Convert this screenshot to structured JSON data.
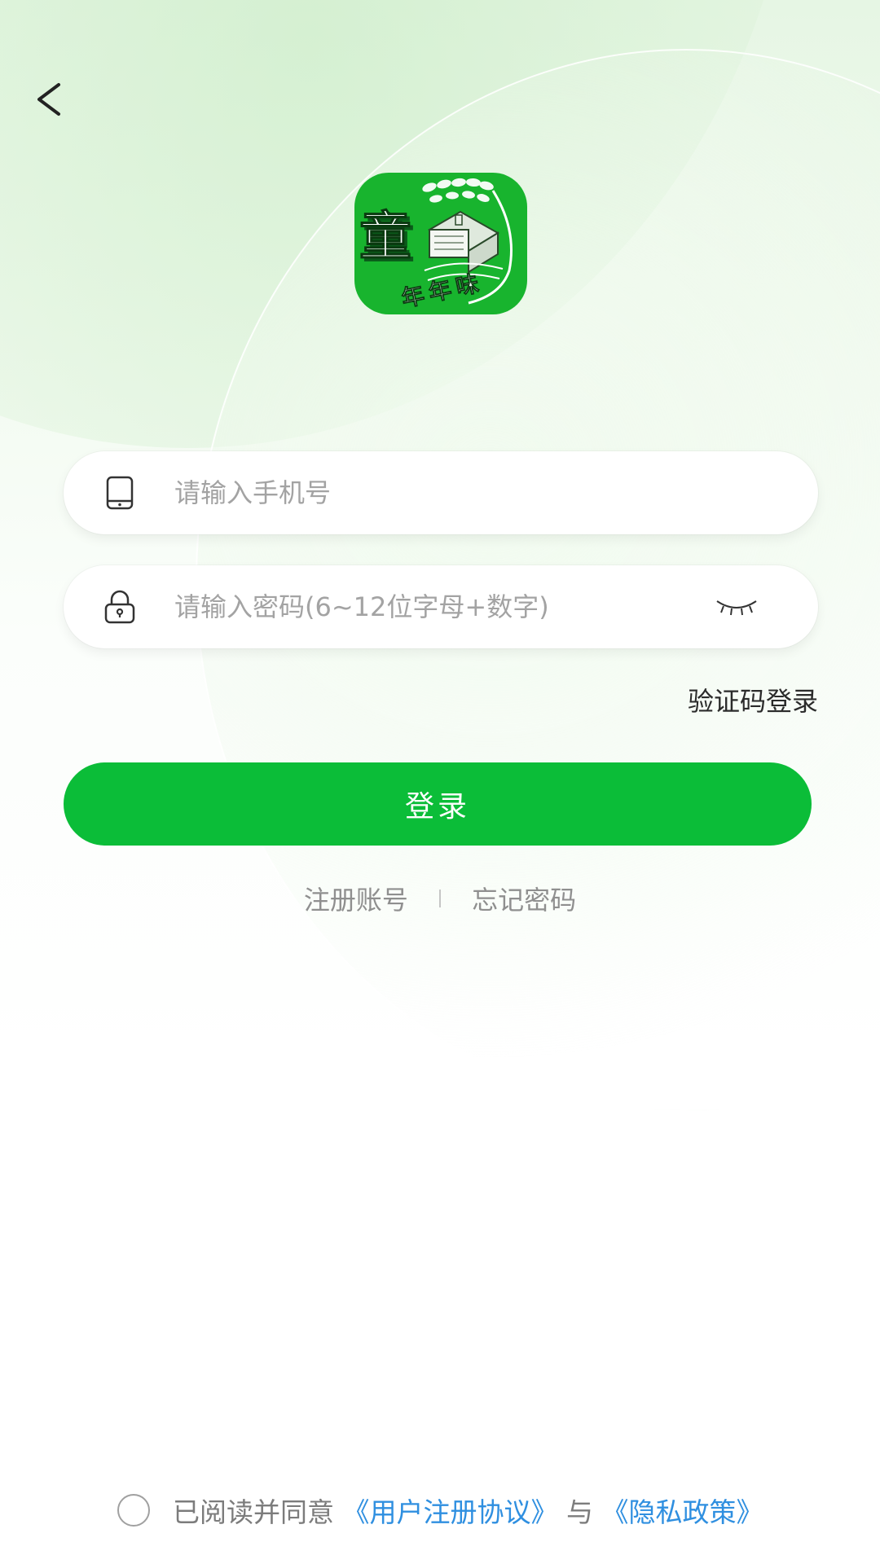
{
  "login": {
    "phone_placeholder": "请输入手机号",
    "password_placeholder": "请输入密码(6~12位字母+数字)",
    "sms_login_label": "验证码登录",
    "login_button_label": "登录",
    "register_label": "注册账号",
    "forgot_password_label": "忘记密码"
  },
  "logo": {
    "main_char": "童",
    "sub_text": "年年味"
  },
  "agreement": {
    "prefix": "已阅读并同意",
    "user_agreement": "《用户注册协议》",
    "connector": "与",
    "privacy_policy": "《隐私政策》"
  },
  "icons": {
    "back": "chevron-left-icon",
    "phone": "phone-icon",
    "lock": "lock-icon",
    "eye": "eye-closed-icon"
  },
  "colors": {
    "primary_green": "#0bbd38",
    "logo_green": "#18b42e",
    "link_blue": "#2f8fe0",
    "placeholder_gray": "#a3a3a3"
  }
}
